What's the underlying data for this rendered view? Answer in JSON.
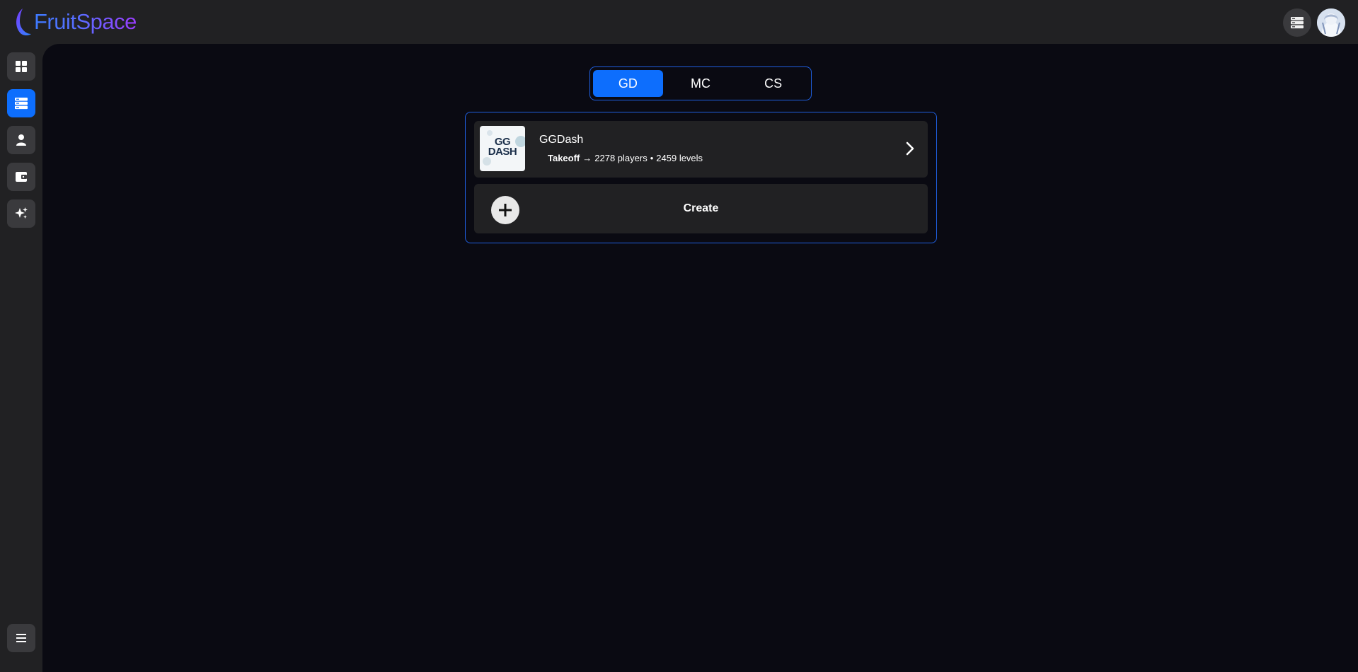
{
  "brand": {
    "name": "FruitSpace"
  },
  "colors": {
    "accent": "#0d6efd",
    "logo_gradient_start": "#3d7bff",
    "logo_gradient_end": "#9b3cff"
  },
  "sidebar": {
    "items": [
      {
        "icon": "dashboard-icon"
      },
      {
        "icon": "servers-icon",
        "active": true
      },
      {
        "icon": "profile-icon"
      },
      {
        "icon": "wallet-icon"
      },
      {
        "icon": "sparkles-icon"
      }
    ],
    "menu_icon": "hamburger-menu-icon"
  },
  "header": {
    "server_icon": "servers-icon",
    "avatar_icon": "user-avatar"
  },
  "tabs": [
    {
      "label": "GD",
      "active": true
    },
    {
      "label": "MC",
      "active": false
    },
    {
      "label": "CS",
      "active": false
    }
  ],
  "servers": [
    {
      "name": "GGDash",
      "thumb_text_1": "GG",
      "thumb_text_2": "DASH",
      "plan": "Takeoff",
      "arrow": "→",
      "players": "2278 players",
      "separator": "•",
      "levels": "2459 levels"
    }
  ],
  "create": {
    "label": "Create"
  }
}
